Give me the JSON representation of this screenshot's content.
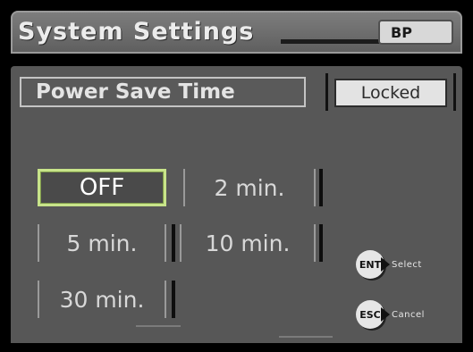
{
  "window": {
    "title": "System Settings",
    "badge": "BP"
  },
  "field": {
    "label": "Power Save Time",
    "status": "Locked"
  },
  "options": [
    {
      "label": "OFF",
      "selected": true
    },
    {
      "label": "2 min.",
      "selected": false
    },
    {
      "label": "5 min.",
      "selected": false
    },
    {
      "label": "10 min.",
      "selected": false
    },
    {
      "label": "30 min.",
      "selected": false
    }
  ],
  "hints": {
    "enter": {
      "key": "ENT",
      "label": "Select"
    },
    "escape": {
      "key": "ESC",
      "label": "Cancel"
    }
  },
  "colors": {
    "background": "#000000",
    "panel": "#575757",
    "selected_border": "#c8e48a",
    "text": "#e4e4e4"
  }
}
